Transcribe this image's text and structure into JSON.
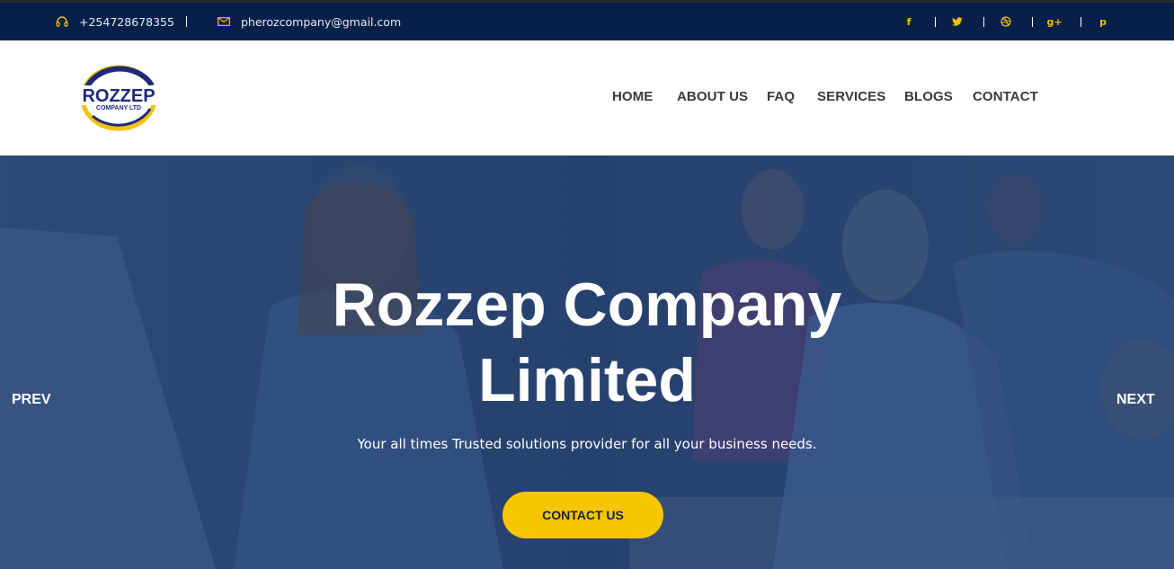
{
  "topbar": {
    "phone": "+254728678355",
    "email": "pherozcompany@gmail.com",
    "social": [
      {
        "icon": "facebook-icon",
        "glyph": "f"
      },
      {
        "icon": "twitter-icon",
        "glyph": "t"
      },
      {
        "icon": "dribbble-icon",
        "glyph": "◎"
      },
      {
        "icon": "google-plus-icon",
        "glyph": "g+"
      },
      {
        "icon": "pinterest-icon",
        "glyph": "p"
      }
    ]
  },
  "logo": {
    "main": "ROZZEP",
    "sub": "COMPANY LTD"
  },
  "nav": {
    "items": [
      {
        "label": "HOME"
      },
      {
        "label": "ABOUT US"
      },
      {
        "label": "FAQ"
      },
      {
        "label": "SERVICES"
      },
      {
        "label": "BLOGS"
      },
      {
        "label": "CONTACT"
      }
    ]
  },
  "hero": {
    "title_line1": "Rozzep Company",
    "title_line2": "Limited",
    "subtitle": "Your all times Trusted solutions provider for all your business needs.",
    "cta_label": "CONTACT US",
    "prev_label": "PREV",
    "next_label": "NEXT"
  },
  "colors": {
    "topbar_bg": "#06204a",
    "accent_yellow": "#f7c600",
    "hero_overlay": "#1f3a6a"
  }
}
